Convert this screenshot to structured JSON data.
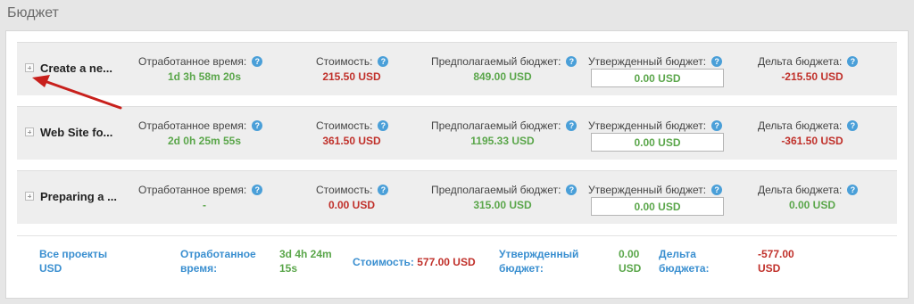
{
  "page": {
    "title": "Бюджет"
  },
  "labels": {
    "worked_time": "Отработанное время:",
    "cost": "Стоимость:",
    "estimated_budget": "Предполагаемый бюджет:",
    "approved_budget": "Утвержденный бюджет:",
    "budget_delta": "Дельта бюджета:",
    "help_glyph": "?"
  },
  "projects": [
    {
      "name": "Create a ne...",
      "worked_time": "1d 3h 58m 20s",
      "cost": "215.50 USD",
      "estimated_budget": "849.00 USD",
      "approved_budget": "0.00 USD",
      "budget_delta": "-215.50 USD"
    },
    {
      "name": "Web Site fo...",
      "worked_time": "2d 0h 25m 55s",
      "cost": "361.50 USD",
      "estimated_budget": "1195.33 USD",
      "approved_budget": "0.00 USD",
      "budget_delta": "-361.50 USD"
    },
    {
      "name": "Preparing a ...",
      "worked_time": "-",
      "cost": "0.00 USD",
      "estimated_budget": "315.00 USD",
      "approved_budget": "0.00 USD",
      "budget_delta": "0.00 USD"
    }
  ],
  "totals": {
    "all_projects_line1": "Все проекты",
    "all_projects_line2": "USD",
    "worked_time_label_line1": "Отработанное",
    "worked_time_label_line2": "время:",
    "worked_time_value_line1": "3d 4h 24m",
    "worked_time_value_line2": "15s",
    "cost_label": "Стоимость:",
    "cost_value": "577.00 USD",
    "approved_label_line1": "Утвержденный",
    "approved_label_line2": "бюджет:",
    "approved_value_line1": "0.00",
    "approved_value_line2": "USD",
    "delta_label_line1": "Дельта",
    "delta_label_line2": "бюджета:",
    "delta_value_line1": "-577.00",
    "delta_value_line2": "USD"
  },
  "colors": {
    "positive": "#5aa64a",
    "negative": "#c0302a",
    "link": "#3a8fd0",
    "annotation_arrow": "#c8201c"
  },
  "icons": {
    "expand": "plus-square-icon",
    "help": "question-circle-icon",
    "annotation": "red-arrow"
  }
}
